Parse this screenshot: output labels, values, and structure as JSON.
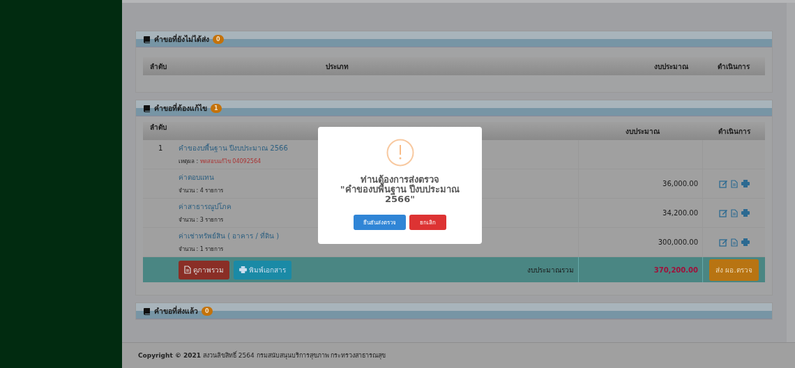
{
  "sections": [
    {
      "kind": "empty",
      "title": "คำขอที่ยังไม่ได้ส่ง",
      "count": "0",
      "columns": [
        "ลำดับ",
        "ประเภท",
        "งบประมาณ",
        "ดำเนินการ"
      ]
    },
    {
      "kind": "table",
      "title": "คำขอที่ต้องแก้ไข",
      "count": "1",
      "columns": [
        "ลำดับ",
        "งบประมาณ",
        "ดำเนินการ"
      ],
      "request": {
        "number": "1",
        "title": "คำของบพื้นฐาน ปีงบประมาณ 2566",
        "reason_label": "เหตุผล :",
        "reason": "ทดสอบแก้ไข 04092564"
      },
      "items": [
        {
          "name": "ค่าตอบแทน",
          "count": "จำนวน : 4 รายการ",
          "amount": "36,000.00"
        },
        {
          "name": "ค่าสาธารณูปโภค",
          "count": "จำนวน : 3 รายการ",
          "amount": "34,200.00"
        },
        {
          "name": "ค่าเช่าทรัพย์สิน ( อาคาร / ที่ดิน )",
          "count": "จำนวน : 1 รายการ",
          "amount": "300,000.00"
        }
      ],
      "total": {
        "overview_button": "ดูภาพรวม",
        "print_button": "พิมพ์เอกสาร",
        "label": "งบประมาณรวม",
        "amount": "370,200.00",
        "submit_button": "ส่ง ผอ.ตรวจ"
      }
    },
    {
      "kind": "header",
      "title": "คำขอที่ส่งแล้ว",
      "count": "0"
    }
  ],
  "footer": "**Copyright © 2021** สงวนลิขสิทธิ์ 2564 กรมสนับสนุนบริการสุขภาพ กระทรวงสาธารณสุข",
  "modal": {
    "title": "ท่านต้องการส่งตรวจ",
    "message": "\"คำของบพื้นฐาน ปีงบประมาณ 2566\"",
    "confirm_button": "ยืนยันส่งตรวจ",
    "cancel_button": "ยกเลิก"
  }
}
